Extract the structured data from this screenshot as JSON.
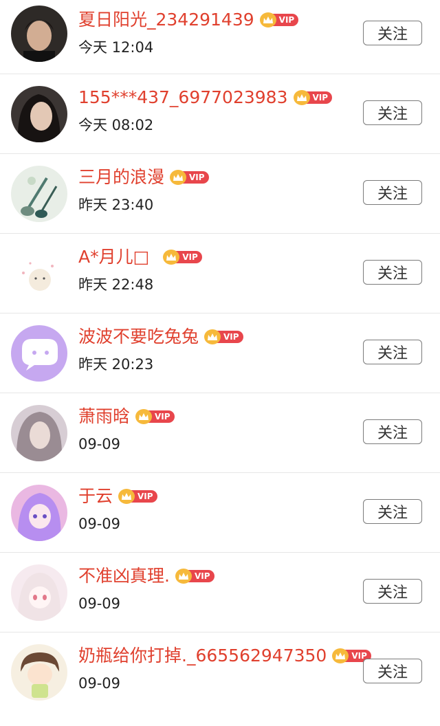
{
  "users": [
    {
      "name": "夏日阳光_234291439",
      "time": "今天 12:04",
      "vip": "VIP",
      "follow": "关注",
      "avatar_colors": [
        "#2b2320",
        "#c9a58a"
      ]
    },
    {
      "name": "155***437_6977023983",
      "time": "今天 08:02",
      "vip": "VIP",
      "follow": "关注",
      "avatar_colors": [
        "#1e1a19",
        "#d8b9a5"
      ]
    },
    {
      "name": "三月的浪漫",
      "time": "昨天 23:40",
      "vip": "VIP",
      "follow": "关注",
      "avatar_colors": [
        "#e9efe8",
        "#3f6b63"
      ]
    },
    {
      "name": "A*月儿□",
      "time": "昨天 22:48",
      "vip": "VIP",
      "follow": "关注",
      "avatar_colors": [
        "#ffffff",
        "#f2e6d6"
      ]
    },
    {
      "name": "波波不要吃兔兔",
      "time": "昨天 20:23",
      "vip": "VIP",
      "follow": "关注",
      "avatar_colors": [
        "#c8aaf0",
        "#ffffff"
      ]
    },
    {
      "name": "萧雨晗",
      "time": "09-09",
      "vip": "VIP",
      "follow": "关注",
      "avatar_colors": [
        "#d9cfd6",
        "#8a7f86"
      ]
    },
    {
      "name": "于云",
      "time": "09-09",
      "vip": "VIP",
      "follow": "关注",
      "avatar_colors": [
        "#e9b7e3",
        "#7f6ad8"
      ]
    },
    {
      "name": "不准凶真理.",
      "time": "09-09",
      "vip": "VIP",
      "follow": "关注",
      "avatar_colors": [
        "#f5e9ee",
        "#e58a98"
      ]
    },
    {
      "name": "奶瓶给你打掉._665562947350",
      "time": "09-09",
      "vip": "VIP",
      "follow": "关注",
      "avatar_colors": [
        "#f5efe2",
        "#6c4a36"
      ]
    }
  ]
}
